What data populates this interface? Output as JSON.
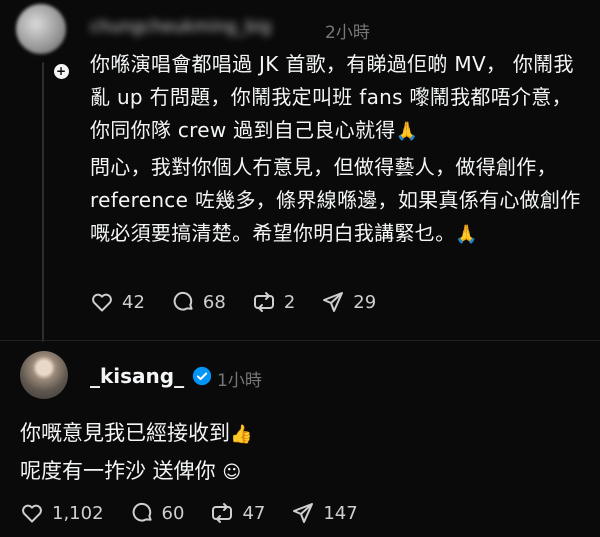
{
  "top_comment": {
    "username": "chungcheukming_big",
    "time": "2小時",
    "paragraphs": [
      "你喺演唱會都唱過 JK 首歌，有睇過佢啲 MV， 你鬧我亂 up 冇問題，你鬧我定叫班 fans 嚟鬧我都唔介意，你同你隊 crew 過到自己良心就得",
      "問心，我對你個人冇意見，但做得藝人，做得創作， reference 咗幾多，條界線喺邊，如果真係有心做創作嘅必須要搞清楚。希望你明白我講緊乜。"
    ],
    "emoji": "🙏",
    "stats": {
      "likes": "42",
      "comments": "68",
      "reposts": "2",
      "shares": "29"
    }
  },
  "reply": {
    "username": "_kisang_",
    "time": "1小時",
    "lines": [
      "你嘅意見我已經接收到",
      "呢度有一拃沙 送俾你"
    ],
    "emoji_line1": "👍",
    "emoji_line2": "☺",
    "stats": {
      "likes": "1,102",
      "comments": "60",
      "reposts": "47",
      "shares": "147"
    }
  },
  "icons": {
    "like": "heart-icon",
    "comment": "comment-bubble-icon",
    "repost": "repost-icon",
    "share": "send-icon",
    "verified": "verified-badge-icon"
  },
  "colors": {
    "background": "#0a0a0a",
    "text": "#f3f5f7",
    "muted": "#777777",
    "verified": "#0095f6"
  }
}
